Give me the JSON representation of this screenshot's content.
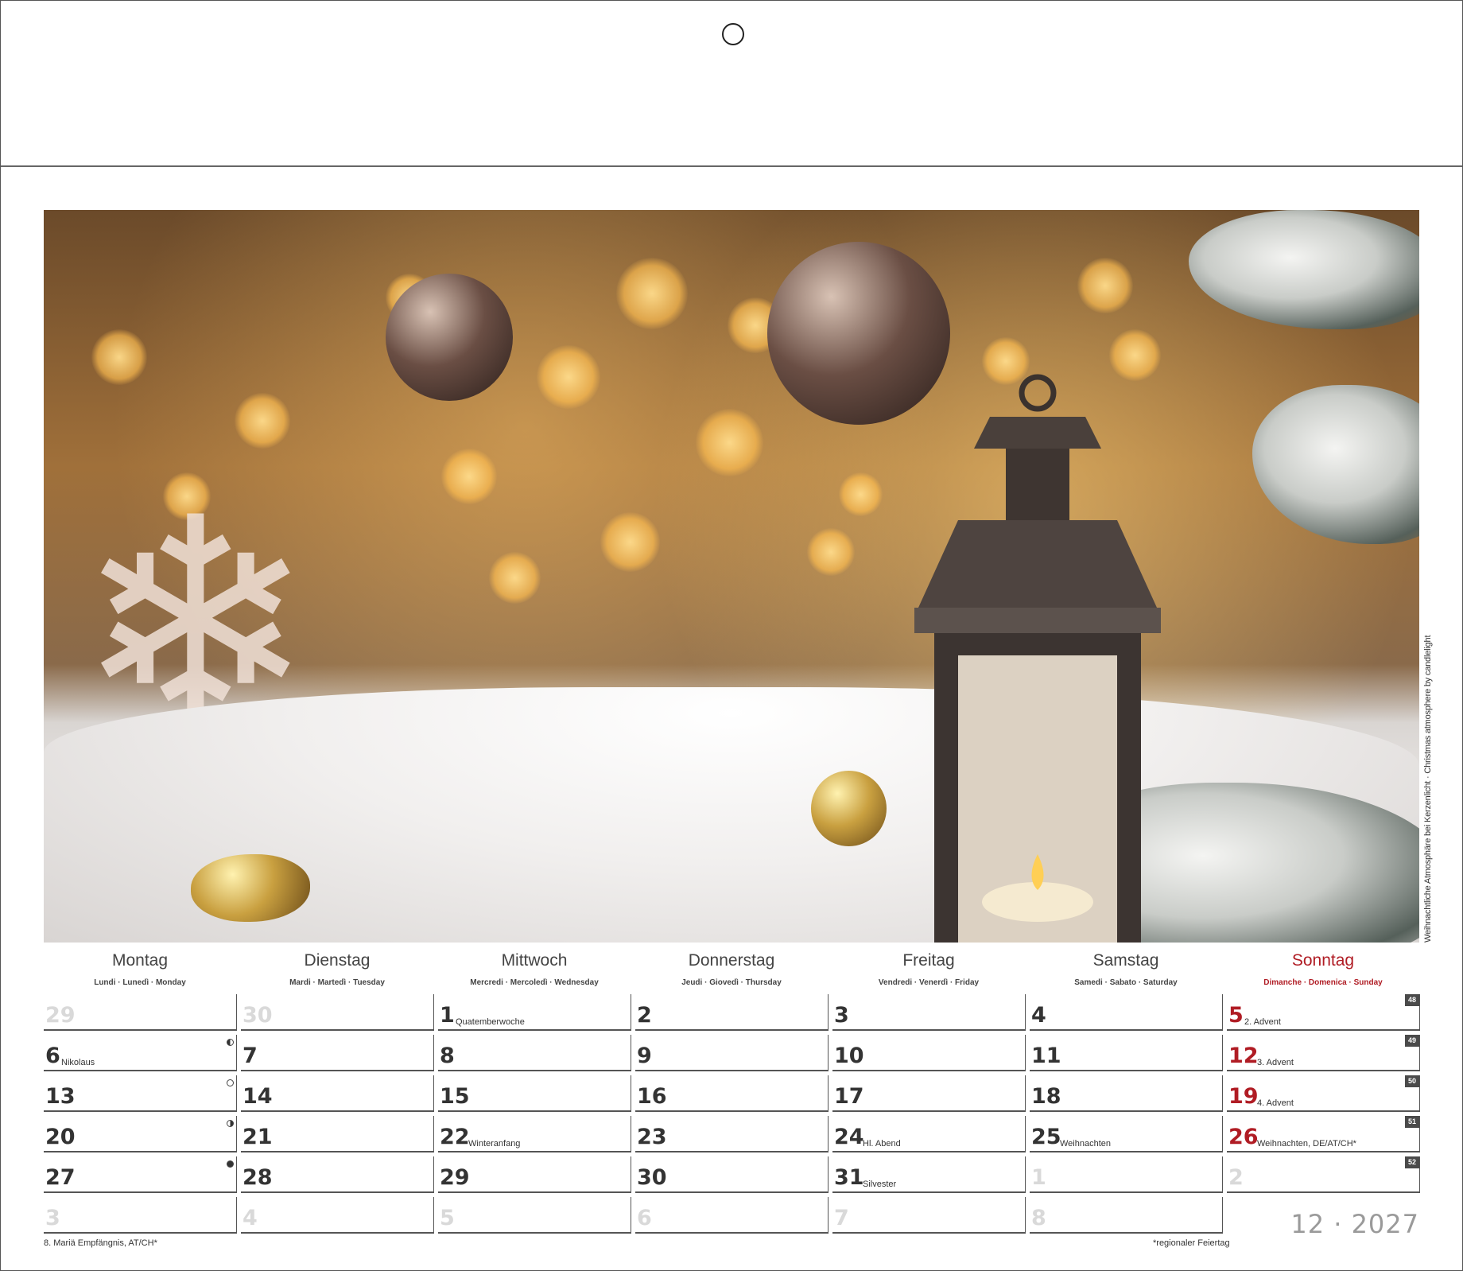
{
  "photo": {
    "caption": "Weihnachtliche Atmosphäre bei Kerzenlicht · Christmas atmosphere by candlelight"
  },
  "weekdays": [
    {
      "name": "Montag",
      "sub": "Lundi · Lunedì · Monday"
    },
    {
      "name": "Dienstag",
      "sub": "Mardi · Martedì · Tuesday"
    },
    {
      "name": "Mittwoch",
      "sub": "Mercredi · Mercoledì · Wednesday"
    },
    {
      "name": "Donnerstag",
      "sub": "Jeudi · Giovedì · Thursday"
    },
    {
      "name": "Freitag",
      "sub": "Vendredi · Venerdì · Friday"
    },
    {
      "name": "Samstag",
      "sub": "Samedi · Sabato · Saturday"
    },
    {
      "name": "Sonntag",
      "sub": "Dimanche · Domenica · Sunday"
    }
  ],
  "weeks": [
    {
      "kw": "48",
      "days": [
        {
          "d": "29",
          "faded": true
        },
        {
          "d": "30",
          "faded": true
        },
        {
          "d": "1",
          "note": "Quatemberwoche"
        },
        {
          "d": "2"
        },
        {
          "d": "3"
        },
        {
          "d": "4"
        },
        {
          "d": "5",
          "note": "2. Advent"
        }
      ]
    },
    {
      "kw": "49",
      "days": [
        {
          "d": "6",
          "note": "Nikolaus",
          "moon": "last"
        },
        {
          "d": "7"
        },
        {
          "d": "8"
        },
        {
          "d": "9"
        },
        {
          "d": "10"
        },
        {
          "d": "11"
        },
        {
          "d": "12",
          "note": "3. Advent"
        }
      ]
    },
    {
      "kw": "50",
      "days": [
        {
          "d": "13",
          "moon": "full"
        },
        {
          "d": "14"
        },
        {
          "d": "15"
        },
        {
          "d": "16"
        },
        {
          "d": "17"
        },
        {
          "d": "18"
        },
        {
          "d": "19",
          "note": "4. Advent"
        }
      ]
    },
    {
      "kw": "51",
      "days": [
        {
          "d": "20",
          "moon": "first"
        },
        {
          "d": "21"
        },
        {
          "d": "22",
          "note": "Winteranfang"
        },
        {
          "d": "23"
        },
        {
          "d": "24",
          "note": "Hl. Abend"
        },
        {
          "d": "25",
          "note": "Weihnachten"
        },
        {
          "d": "26",
          "note": "Weihnachten, DE/AT/CH*"
        }
      ]
    },
    {
      "kw": "52",
      "days": [
        {
          "d": "27",
          "moon": "new"
        },
        {
          "d": "28"
        },
        {
          "d": "29"
        },
        {
          "d": "30"
        },
        {
          "d": "31",
          "note": "Silvester"
        },
        {
          "d": "1",
          "faded": true
        },
        {
          "d": "2",
          "faded": true
        }
      ]
    },
    {
      "kw": "",
      "days": [
        {
          "d": "3",
          "faded": true
        },
        {
          "d": "4",
          "faded": true
        },
        {
          "d": "5",
          "faded": true
        },
        {
          "d": "6",
          "faded": true
        },
        {
          "d": "7",
          "faded": true
        },
        {
          "d": "8",
          "faded": true
        },
        null
      ]
    }
  ],
  "month_label": "12 · 2027",
  "footer": {
    "holiday_note": "8. Mariä Empfängnis, AT/CH*",
    "regional_note": "*regionaler Feiertag"
  },
  "colors": {
    "sunday": "#b01c24",
    "faded": "#d9d9d9",
    "week_badge": "#4a4a4a"
  }
}
